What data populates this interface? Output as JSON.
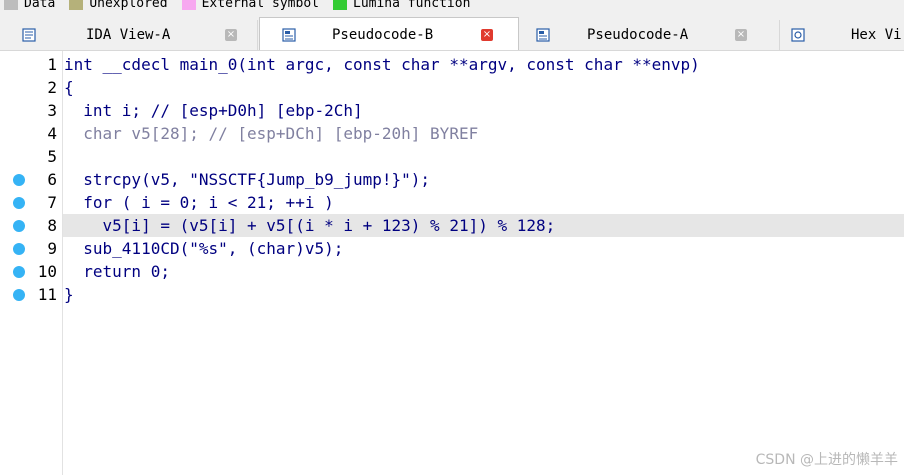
{
  "legend": [
    {
      "label": "Data",
      "color": "#bdbdbd"
    },
    {
      "label": "Unexplored",
      "color": "#b5b17a"
    },
    {
      "label": "External symbol",
      "color": "#f7a8f0"
    },
    {
      "label": "Lumina function",
      "color": "#33cc33"
    }
  ],
  "tabs": [
    {
      "label": "IDA View-A",
      "icon": "disassembly-view-icon",
      "close": "×",
      "active": false
    },
    {
      "label": "Pseudocode-B",
      "icon": "pseudocode-view-icon",
      "close": "×",
      "active": true
    },
    {
      "label": "Pseudocode-A",
      "icon": "pseudocode-view-icon",
      "close": "×",
      "active": false
    },
    {
      "label": "Hex Vi",
      "icon": "hex-view-icon",
      "close": "",
      "active": false
    }
  ],
  "code": {
    "lines": [
      {
        "num": "1",
        "text": "int __cdecl main_0(int argc, const char **argv, const char **envp)",
        "bp": false
      },
      {
        "num": "2",
        "text": "{",
        "bp": false
      },
      {
        "num": "3",
        "text": "  int i; // [esp+D0h] [ebp-2Ch]",
        "bp": false
      },
      {
        "num": "4",
        "text": "  char v5[28]; // [esp+DCh] [ebp-20h] BYREF",
        "bp": false
      },
      {
        "num": "5",
        "text": "",
        "bp": false
      },
      {
        "num": "6",
        "text": "  strcpy(v5, \"NSSCTF{Jump_b9_jump!}\");",
        "bp": true
      },
      {
        "num": "7",
        "text": "  for ( i = 0; i < 21; ++i )",
        "bp": true
      },
      {
        "num": "8",
        "text": "    v5[i] = (v5[i] + v5[(i * i + 123) % 21]) % 128;",
        "bp": true
      },
      {
        "num": "9",
        "text": "  sub_4110CD(\"%s\", (char)v5);",
        "bp": true
      },
      {
        "num": "10",
        "text": "  return 0;",
        "bp": true
      },
      {
        "num": "11",
        "text": "}",
        "bp": true
      }
    ],
    "highlight_line": "8"
  },
  "watermark": "CSDN @上进的懒羊羊"
}
